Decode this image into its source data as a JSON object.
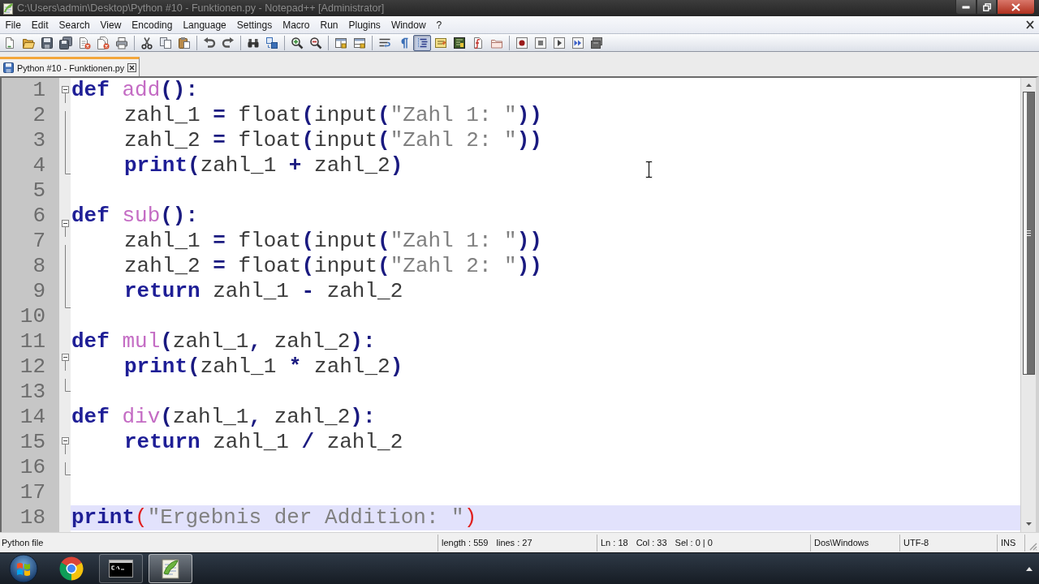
{
  "window": {
    "title": "C:\\Users\\admin\\Desktop\\Python #10 - Funktionen.py - Notepad++ [Administrator]"
  },
  "menu": [
    "File",
    "Edit",
    "Search",
    "View",
    "Encoding",
    "Language",
    "Settings",
    "Macro",
    "Run",
    "Plugins",
    "Window",
    "?"
  ],
  "toolbar": {
    "groups": [
      [
        {
          "pressed": false
        },
        {
          "pressed": false
        },
        {
          "pressed": false
        },
        {
          "pressed": false
        },
        {
          "pressed": false
        },
        {
          "pressed": false
        },
        {
          "pressed": false
        }
      ],
      [
        {
          "pressed": false
        },
        {
          "pressed": false
        },
        {
          "pressed": false
        }
      ],
      [
        {
          "pressed": false
        },
        {
          "pressed": false
        }
      ],
      [
        {
          "pressed": false
        },
        {
          "pressed": false
        }
      ],
      [
        {
          "pressed": false
        },
        {
          "pressed": false
        }
      ],
      [
        {
          "pressed": false
        },
        {
          "pressed": false
        }
      ],
      [
        {
          "pressed": false
        },
        {
          "pressed": false
        },
        {
          "pressed": true
        },
        {
          "pressed": false
        },
        {
          "pressed": false
        },
        {
          "pressed": false
        },
        {
          "pressed": false
        }
      ],
      [
        {
          "pressed": false
        },
        {
          "pressed": false
        },
        {
          "pressed": false
        },
        {
          "pressed": false
        },
        {
          "pressed": false
        }
      ]
    ]
  },
  "tabs": [
    {
      "label": "Python #10 - Funktionen.py",
      "selected": true
    }
  ],
  "editor": {
    "lines": [
      {
        "number": "1",
        "current": false,
        "expanded": true,
        "tokens": [
          {
            "kind": "keyword",
            "text": "def "
          },
          {
            "kind": "defname",
            "text": "add"
          },
          {
            "kind": "operator",
            "text": "():"
          }
        ],
        "children": [
          {
            "number": "2",
            "current": false,
            "tokens": [
              {
                "kind": "identifier",
                "text": "zahl_1 "
              },
              {
                "kind": "operator",
                "text": "="
              },
              {
                "kind": "identifier",
                "text": " float"
              },
              {
                "kind": "operator",
                "text": "("
              },
              {
                "kind": "identifier",
                "text": "input"
              },
              {
                "kind": "operator",
                "text": "("
              },
              {
                "kind": "string",
                "text": "\"Zahl 1: \""
              },
              {
                "kind": "operator",
                "text": "))"
              }
            ]
          },
          {
            "number": "3",
            "current": false,
            "tokens": [
              {
                "kind": "identifier",
                "text": "zahl_2 "
              },
              {
                "kind": "operator",
                "text": "="
              },
              {
                "kind": "identifier",
                "text": " float"
              },
              {
                "kind": "operator",
                "text": "("
              },
              {
                "kind": "identifier",
                "text": "input"
              },
              {
                "kind": "operator",
                "text": "("
              },
              {
                "kind": "string",
                "text": "\"Zahl 2: \""
              },
              {
                "kind": "operator",
                "text": "))"
              }
            ]
          },
          {
            "number": "4",
            "current": false,
            "tokens": [
              {
                "kind": "keyword",
                "text": "print"
              },
              {
                "kind": "operator",
                "text": "("
              },
              {
                "kind": "identifier",
                "text": "zahl_1 "
              },
              {
                "kind": "operator",
                "text": "+"
              },
              {
                "kind": "identifier",
                "text": " zahl_2"
              },
              {
                "kind": "operator",
                "text": ")"
              }
            ]
          }
        ]
      },
      {
        "number": "5",
        "current": false
      },
      {
        "number": "6",
        "current": false,
        "expanded": true,
        "tokens": [
          {
            "kind": "keyword",
            "text": "def "
          },
          {
            "kind": "defname",
            "text": "sub"
          },
          {
            "kind": "operator",
            "text": "():"
          }
        ],
        "children": [
          {
            "number": "7",
            "current": false,
            "tokens": [
              {
                "kind": "identifier",
                "text": "zahl_1 "
              },
              {
                "kind": "operator",
                "text": "="
              },
              {
                "kind": "identifier",
                "text": " float"
              },
              {
                "kind": "operator",
                "text": "("
              },
              {
                "kind": "identifier",
                "text": "input"
              },
              {
                "kind": "operator",
                "text": "("
              },
              {
                "kind": "string",
                "text": "\"Zahl 1: \""
              },
              {
                "kind": "operator",
                "text": "))"
              }
            ]
          },
          {
            "number": "8",
            "current": false,
            "tokens": [
              {
                "kind": "identifier",
                "text": "zahl_2 "
              },
              {
                "kind": "operator",
                "text": "="
              },
              {
                "kind": "identifier",
                "text": " float"
              },
              {
                "kind": "operator",
                "text": "("
              },
              {
                "kind": "identifier",
                "text": "input"
              },
              {
                "kind": "operator",
                "text": "("
              },
              {
                "kind": "string",
                "text": "\"Zahl 2: \""
              },
              {
                "kind": "operator",
                "text": "))"
              }
            ]
          },
          {
            "number": "9",
            "current": false,
            "tokens": [
              {
                "kind": "keyword",
                "text": "return"
              },
              {
                "kind": "identifier",
                "text": " zahl_1 "
              },
              {
                "kind": "operator",
                "text": "-"
              },
              {
                "kind": "identifier",
                "text": " zahl_2"
              }
            ]
          }
        ]
      },
      {
        "number": "10",
        "current": false
      },
      {
        "number": "11",
        "current": false,
        "expanded": true,
        "tokens": [
          {
            "kind": "keyword",
            "text": "def "
          },
          {
            "kind": "defname",
            "text": "mul"
          },
          {
            "kind": "operator",
            "text": "("
          },
          {
            "kind": "identifier",
            "text": "zahl_1"
          },
          {
            "kind": "operator",
            "text": ","
          },
          {
            "kind": "identifier",
            "text": " zahl_2"
          },
          {
            "kind": "operator",
            "text": "):"
          }
        ],
        "children": [
          {
            "number": "12",
            "current": false,
            "tokens": [
              {
                "kind": "keyword",
                "text": "print"
              },
              {
                "kind": "operator",
                "text": "("
              },
              {
                "kind": "identifier",
                "text": "zahl_1 "
              },
              {
                "kind": "operator",
                "text": "*"
              },
              {
                "kind": "identifier",
                "text": " zahl_2"
              },
              {
                "kind": "operator",
                "text": ")"
              }
            ]
          }
        ]
      },
      {
        "number": "13",
        "current": false
      },
      {
        "number": "14",
        "current": false,
        "expanded": true,
        "tokens": [
          {
            "kind": "keyword",
            "text": "def "
          },
          {
            "kind": "defname",
            "text": "div"
          },
          {
            "kind": "operator",
            "text": "("
          },
          {
            "kind": "identifier",
            "text": "zahl_1"
          },
          {
            "kind": "operator",
            "text": ","
          },
          {
            "kind": "identifier",
            "text": " zahl_2"
          },
          {
            "kind": "operator",
            "text": "):"
          }
        ],
        "children": [
          {
            "number": "15",
            "current": false,
            "tokens": [
              {
                "kind": "keyword",
                "text": "return"
              },
              {
                "kind": "identifier",
                "text": " zahl_1 "
              },
              {
                "kind": "operator",
                "text": "/"
              },
              {
                "kind": "identifier",
                "text": " zahl_2"
              }
            ]
          }
        ]
      },
      {
        "number": "16",
        "current": false
      },
      {
        "number": "17",
        "current": false
      },
      {
        "number": "18",
        "current": true,
        "tokens": [
          {
            "kind": "keyword",
            "text": "print"
          },
          {
            "kind": "brace_match",
            "text": "("
          },
          {
            "kind": "string",
            "text": "\"Ergebnis der Addition: \""
          },
          {
            "kind": "brace_match",
            "text": ")"
          }
        ]
      }
    ]
  },
  "status_bar": {
    "panels": [
      {
        "texts": [
          "Python file"
        ]
      },
      {
        "texts": [
          "length : 559",
          "lines : 27"
        ]
      },
      {
        "texts": [
          "Ln : 18",
          "Col : 33",
          "Sel : 0 | 0"
        ]
      },
      {
        "texts": [
          "Dos\\Windows"
        ]
      },
      {
        "texts": [
          "UTF-8"
        ]
      },
      {
        "texts": [
          "INS"
        ]
      }
    ]
  },
  "taskbar": {
    "items": [
      {
        "running": false,
        "selected": false
      },
      {
        "running": true,
        "selected": false
      },
      {
        "running": true,
        "selected": true
      }
    ]
  }
}
